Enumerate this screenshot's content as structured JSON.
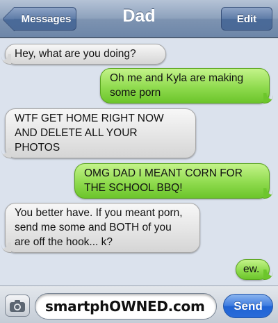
{
  "nav": {
    "back_label": "Messages",
    "title": "Dad",
    "edit_label": "Edit"
  },
  "messages": [
    {
      "from": "contact",
      "text": "Hey, what are you doing?"
    },
    {
      "from": "me",
      "text": "Oh me and Kyla are making some porn"
    },
    {
      "from": "contact",
      "text": "WTF GET HOME RIGHT NOW AND DELETE ALL YOUR PHOTOS"
    },
    {
      "from": "me",
      "text": "OMG DAD I MEANT CORN FOR THE SCHOOL BBQ!"
    },
    {
      "from": "contact",
      "text": "You better have. If you meant porn, send me some and BOTH of you are off the hook... k?"
    },
    {
      "from": "me",
      "text": "ew."
    }
  ],
  "composer": {
    "camera_icon": "camera-icon",
    "text_value": "smartphOWNED.com",
    "send_label": "Send"
  },
  "colors": {
    "incoming_bubble": "#e5e5e5",
    "outgoing_bubble": "#8fdb4e",
    "send_button": "#2a6bd9",
    "background": "#dbe2ed"
  }
}
